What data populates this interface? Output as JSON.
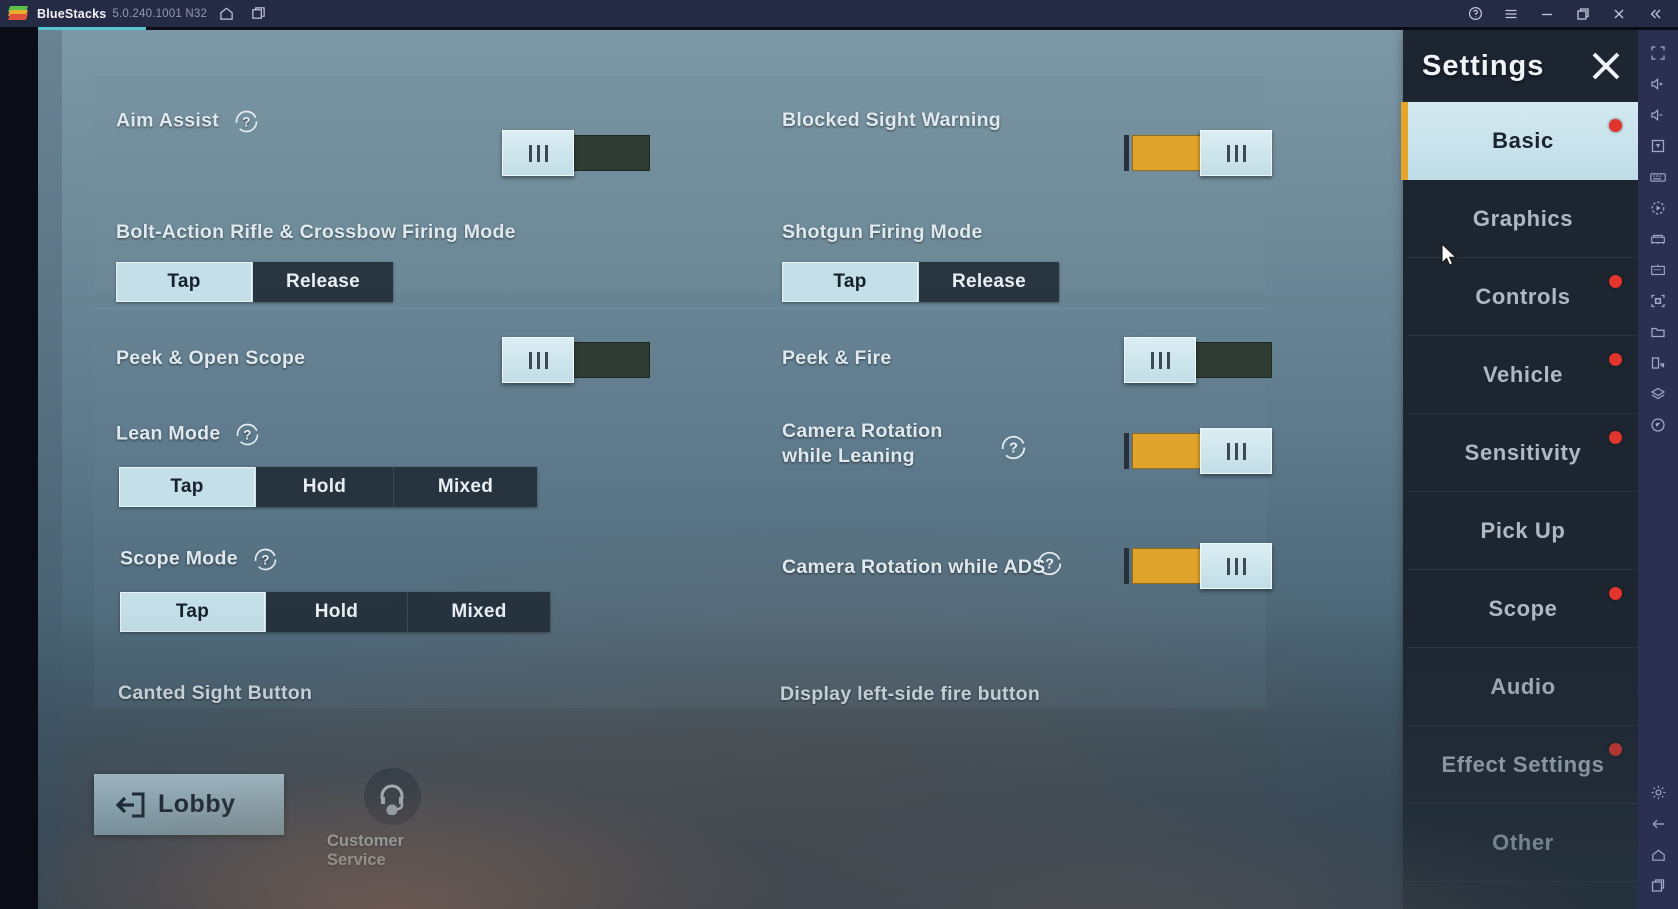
{
  "titlebar": {
    "app_name": "BlueStacks",
    "version": "5.0.240.1001 N32",
    "icons": [
      "home-icon",
      "multi-instance-icon"
    ],
    "right_icons": [
      "help-icon",
      "menu-icon",
      "minimize-icon",
      "maximize-icon",
      "close-icon",
      "collapse-icon"
    ],
    "accent_color": "#57c4cf"
  },
  "rail": {
    "icons": [
      "fullscreen-icon",
      "volume-up-icon",
      "volume-down-icon",
      "game-controls-icon",
      "keymapping-icon",
      "macro-icon",
      "multi-instance-manager-icon",
      "rpg-mode-icon",
      "screenshot-icon",
      "media-folder-icon",
      "rotate-icon",
      "layers-icon",
      "eco-mode-icon",
      "settings-gear-icon",
      "back-icon",
      "home-icon",
      "recents-icon"
    ]
  },
  "settings_panel": {
    "title": "Settings",
    "close_label": "close-icon",
    "accent_color": "#e3a62b",
    "items": [
      {
        "label": "Basic",
        "selected": true,
        "dot": true
      },
      {
        "label": "Graphics",
        "selected": false,
        "dot": false
      },
      {
        "label": "Controls",
        "selected": false,
        "dot": true
      },
      {
        "label": "Vehicle",
        "selected": false,
        "dot": true
      },
      {
        "label": "Sensitivity",
        "selected": false,
        "dot": true
      },
      {
        "label": "Pick Up",
        "selected": false,
        "dot": false
      },
      {
        "label": "Scope",
        "selected": false,
        "dot": true
      },
      {
        "label": "Audio",
        "selected": false,
        "dot": false
      },
      {
        "label": "Effect Settings",
        "selected": false,
        "dot": true
      },
      {
        "label": "Other",
        "selected": false,
        "dot": false
      }
    ]
  },
  "main": {
    "card1": {
      "aim_assist": {
        "label": "Aim Assist",
        "help": true,
        "toggle": "off"
      },
      "blocked_sight": {
        "label": "Blocked Sight Warning",
        "help": false,
        "toggle": "on"
      },
      "bolt_action": {
        "label": "Bolt-Action Rifle & Crossbow Firing Mode",
        "options": [
          "Tap",
          "Release"
        ],
        "selected": "Tap"
      },
      "shotgun": {
        "label": "Shotgun Firing Mode",
        "options": [
          "Tap",
          "Release"
        ],
        "selected": "Tap"
      }
    },
    "card2": {
      "peek_open_scope": {
        "label": "Peek & Open Scope",
        "help": false,
        "toggle": "off"
      },
      "peek_fire": {
        "label": "Peek & Fire",
        "help": false,
        "toggle": "off"
      },
      "lean_mode": {
        "label": "Lean Mode",
        "help": true,
        "options": [
          "Tap",
          "Hold",
          "Mixed"
        ],
        "selected": "Tap"
      },
      "cam_rot_lean": {
        "label": "Camera Rotation while Leaning",
        "help": true,
        "toggle": "on"
      },
      "scope_mode": {
        "label": "Scope Mode",
        "help": true,
        "options": [
          "Tap",
          "Hold",
          "Mixed"
        ],
        "selected": "Tap"
      },
      "cam_rot_ads": {
        "label": "Camera Rotation while ADS",
        "help": true,
        "toggle": "on"
      },
      "canted_sight": {
        "label": "Canted Sight Button"
      },
      "display_left_fire": {
        "label": "Display left-side fire button"
      }
    },
    "footer": {
      "lobby_label": "Lobby",
      "lobby_icon": "exit-arrow-icon",
      "customer_service_label": "Customer Service",
      "customer_service_icon": "headset-icon"
    }
  }
}
